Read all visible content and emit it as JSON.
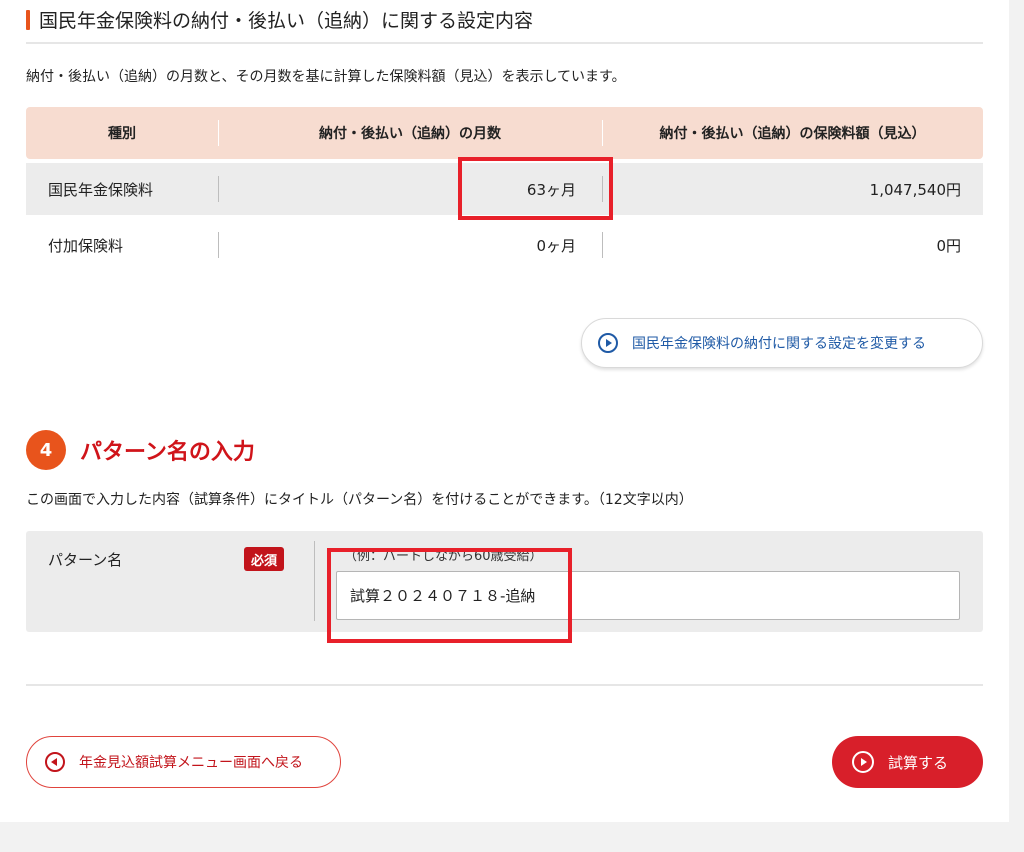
{
  "settings_section": {
    "title": "国民年金保険料の納付・後払い（追納）に関する設定内容",
    "description": "納付・後払い（追納）の月数と、その月数を基に計算した保険料額（見込）を表示しています。"
  },
  "table": {
    "headers": [
      "種別",
      "納付・後払い（追納）の月数",
      "納付・後払い（追納）の保険料額（見込）"
    ],
    "rows": [
      {
        "type": "国民年金保険料",
        "months": "63ヶ月",
        "amount": "1,047,540円"
      },
      {
        "type": "付加保険料",
        "months": "0ヶ月",
        "amount": "0円"
      }
    ]
  },
  "change_button_label": "国民年金保険料の納付に関する設定を変更する",
  "pattern_section": {
    "step_number": "4",
    "title": "パターン名の入力",
    "description": "この画面で入力した内容（試算条件）にタイトル（パターン名）を付けることができます。（12文字以内）",
    "field_label": "パターン名",
    "required_badge": "必須",
    "example": "（例：パートしながら60歳受給）",
    "input_value": "試算２０２４０７１８-追納"
  },
  "back_button_label": "年金見込額試算メニュー画面へ戻る",
  "calc_button_label": "試算する",
  "colors": {
    "accent_orange": "#e8541c",
    "brand_red": "#d81f2a",
    "table_header_bg": "#f7dcd0",
    "link_blue": "#1f5aa6",
    "highlight_box": "#e8202a"
  },
  "icons": {
    "change_button": "play-circle-icon",
    "back_button": "back-circle-icon",
    "calc_button": "play-circle-icon"
  }
}
